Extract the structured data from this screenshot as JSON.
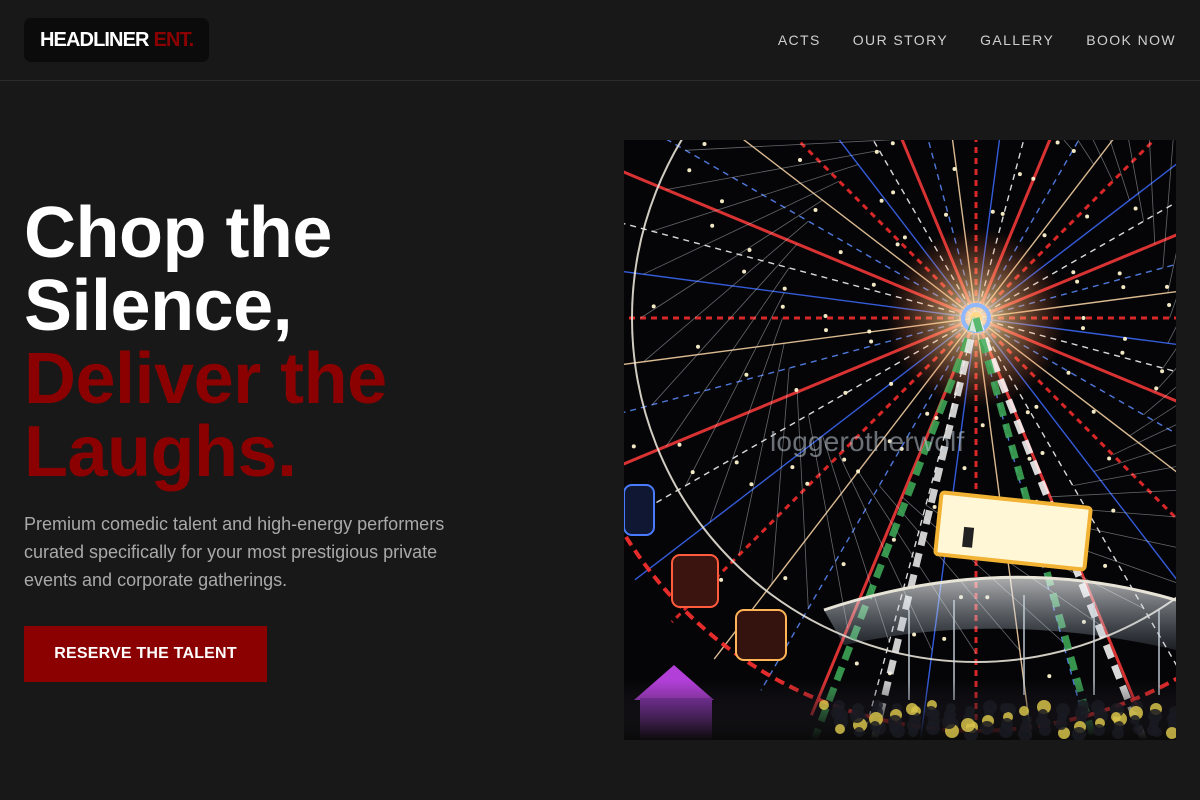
{
  "header": {
    "logo": {
      "main": "HEADLINER",
      "accent": "ENT."
    },
    "nav": [
      {
        "label": "ACTS"
      },
      {
        "label": "OUR STORY"
      },
      {
        "label": "GALLERY"
      },
      {
        "label": "BOOK NOW"
      }
    ]
  },
  "hero": {
    "title_lines": [
      "Chop the",
      "Silence,",
      "Deliver the",
      "Laughs."
    ],
    "description": "Premium comedic talent and high-energy performers curated specifically for your most prestigious private events and corporate gatherings.",
    "cta_label": "RESERVE THE TALENT",
    "image": {
      "subject": "ferris-wheel-night-photo",
      "watermark": "loggerotherwolf"
    }
  },
  "colors": {
    "background": "#181818",
    "accent": "#8b0000",
    "nav_text": "#cfcfcf",
    "body_text": "#a9a9a9"
  }
}
